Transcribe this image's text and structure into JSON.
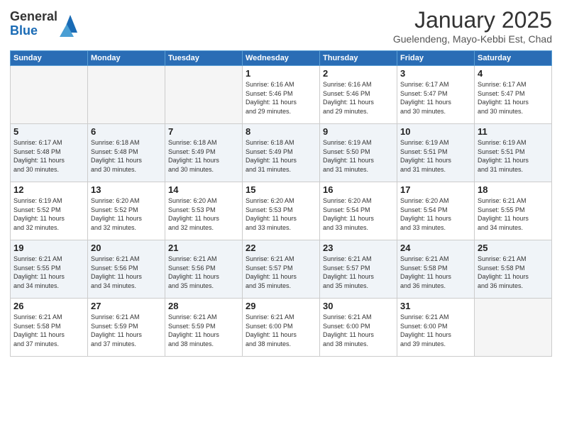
{
  "header": {
    "logo_general": "General",
    "logo_blue": "Blue",
    "title": "January 2025",
    "location": "Guelendeng, Mayo-Kebbi Est, Chad"
  },
  "weekdays": [
    "Sunday",
    "Monday",
    "Tuesday",
    "Wednesday",
    "Thursday",
    "Friday",
    "Saturday"
  ],
  "weeks": [
    {
      "shaded": false,
      "days": [
        {
          "num": "",
          "info": ""
        },
        {
          "num": "",
          "info": ""
        },
        {
          "num": "",
          "info": ""
        },
        {
          "num": "1",
          "info": "Sunrise: 6:16 AM\nSunset: 5:46 PM\nDaylight: 11 hours\nand 29 minutes."
        },
        {
          "num": "2",
          "info": "Sunrise: 6:16 AM\nSunset: 5:46 PM\nDaylight: 11 hours\nand 29 minutes."
        },
        {
          "num": "3",
          "info": "Sunrise: 6:17 AM\nSunset: 5:47 PM\nDaylight: 11 hours\nand 30 minutes."
        },
        {
          "num": "4",
          "info": "Sunrise: 6:17 AM\nSunset: 5:47 PM\nDaylight: 11 hours\nand 30 minutes."
        }
      ]
    },
    {
      "shaded": true,
      "days": [
        {
          "num": "5",
          "info": "Sunrise: 6:17 AM\nSunset: 5:48 PM\nDaylight: 11 hours\nand 30 minutes."
        },
        {
          "num": "6",
          "info": "Sunrise: 6:18 AM\nSunset: 5:48 PM\nDaylight: 11 hours\nand 30 minutes."
        },
        {
          "num": "7",
          "info": "Sunrise: 6:18 AM\nSunset: 5:49 PM\nDaylight: 11 hours\nand 30 minutes."
        },
        {
          "num": "8",
          "info": "Sunrise: 6:18 AM\nSunset: 5:49 PM\nDaylight: 11 hours\nand 31 minutes."
        },
        {
          "num": "9",
          "info": "Sunrise: 6:19 AM\nSunset: 5:50 PM\nDaylight: 11 hours\nand 31 minutes."
        },
        {
          "num": "10",
          "info": "Sunrise: 6:19 AM\nSunset: 5:51 PM\nDaylight: 11 hours\nand 31 minutes."
        },
        {
          "num": "11",
          "info": "Sunrise: 6:19 AM\nSunset: 5:51 PM\nDaylight: 11 hours\nand 31 minutes."
        }
      ]
    },
    {
      "shaded": false,
      "days": [
        {
          "num": "12",
          "info": "Sunrise: 6:19 AM\nSunset: 5:52 PM\nDaylight: 11 hours\nand 32 minutes."
        },
        {
          "num": "13",
          "info": "Sunrise: 6:20 AM\nSunset: 5:52 PM\nDaylight: 11 hours\nand 32 minutes."
        },
        {
          "num": "14",
          "info": "Sunrise: 6:20 AM\nSunset: 5:53 PM\nDaylight: 11 hours\nand 32 minutes."
        },
        {
          "num": "15",
          "info": "Sunrise: 6:20 AM\nSunset: 5:53 PM\nDaylight: 11 hours\nand 33 minutes."
        },
        {
          "num": "16",
          "info": "Sunrise: 6:20 AM\nSunset: 5:54 PM\nDaylight: 11 hours\nand 33 minutes."
        },
        {
          "num": "17",
          "info": "Sunrise: 6:20 AM\nSunset: 5:54 PM\nDaylight: 11 hours\nand 33 minutes."
        },
        {
          "num": "18",
          "info": "Sunrise: 6:21 AM\nSunset: 5:55 PM\nDaylight: 11 hours\nand 34 minutes."
        }
      ]
    },
    {
      "shaded": true,
      "days": [
        {
          "num": "19",
          "info": "Sunrise: 6:21 AM\nSunset: 5:55 PM\nDaylight: 11 hours\nand 34 minutes."
        },
        {
          "num": "20",
          "info": "Sunrise: 6:21 AM\nSunset: 5:56 PM\nDaylight: 11 hours\nand 34 minutes."
        },
        {
          "num": "21",
          "info": "Sunrise: 6:21 AM\nSunset: 5:56 PM\nDaylight: 11 hours\nand 35 minutes."
        },
        {
          "num": "22",
          "info": "Sunrise: 6:21 AM\nSunset: 5:57 PM\nDaylight: 11 hours\nand 35 minutes."
        },
        {
          "num": "23",
          "info": "Sunrise: 6:21 AM\nSunset: 5:57 PM\nDaylight: 11 hours\nand 35 minutes."
        },
        {
          "num": "24",
          "info": "Sunrise: 6:21 AM\nSunset: 5:58 PM\nDaylight: 11 hours\nand 36 minutes."
        },
        {
          "num": "25",
          "info": "Sunrise: 6:21 AM\nSunset: 5:58 PM\nDaylight: 11 hours\nand 36 minutes."
        }
      ]
    },
    {
      "shaded": false,
      "days": [
        {
          "num": "26",
          "info": "Sunrise: 6:21 AM\nSunset: 5:58 PM\nDaylight: 11 hours\nand 37 minutes."
        },
        {
          "num": "27",
          "info": "Sunrise: 6:21 AM\nSunset: 5:59 PM\nDaylight: 11 hours\nand 37 minutes."
        },
        {
          "num": "28",
          "info": "Sunrise: 6:21 AM\nSunset: 5:59 PM\nDaylight: 11 hours\nand 38 minutes."
        },
        {
          "num": "29",
          "info": "Sunrise: 6:21 AM\nSunset: 6:00 PM\nDaylight: 11 hours\nand 38 minutes."
        },
        {
          "num": "30",
          "info": "Sunrise: 6:21 AM\nSunset: 6:00 PM\nDaylight: 11 hours\nand 38 minutes."
        },
        {
          "num": "31",
          "info": "Sunrise: 6:21 AM\nSunset: 6:00 PM\nDaylight: 11 hours\nand 39 minutes."
        },
        {
          "num": "",
          "info": ""
        }
      ]
    }
  ]
}
